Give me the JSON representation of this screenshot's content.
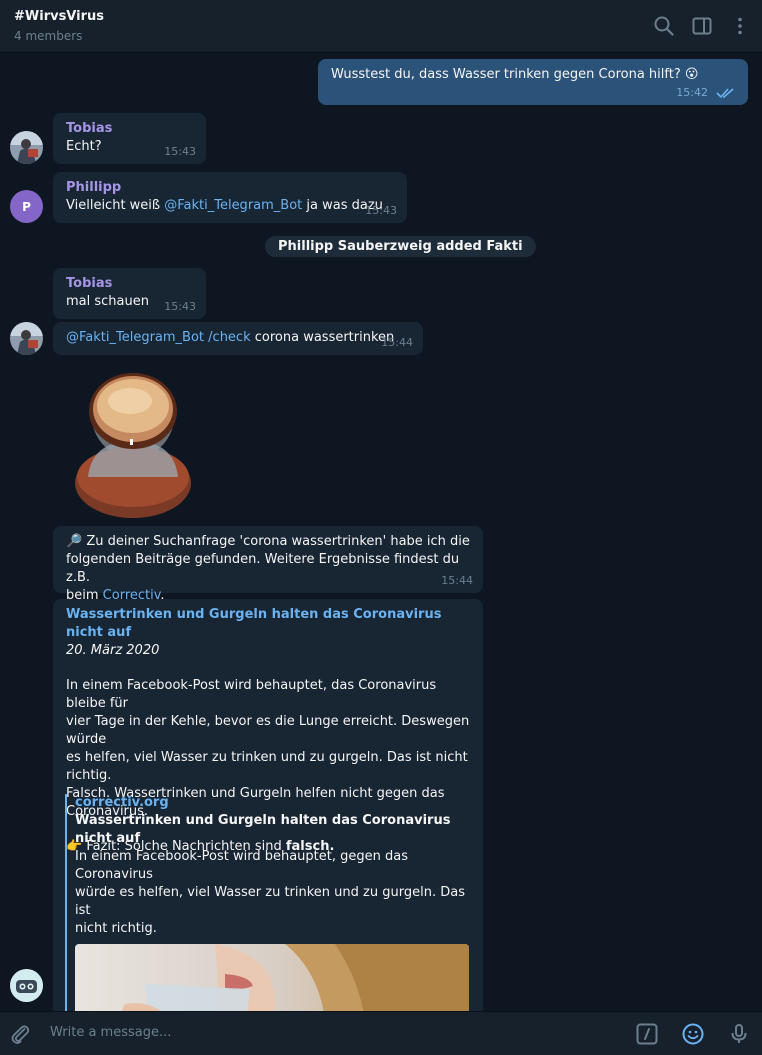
{
  "header": {
    "title": "#WirvsVirus",
    "subtitle": "4 members"
  },
  "messages": {
    "m1": {
      "text": "Wusstest du, dass Wasser trinken gegen Corona hilft? 😮",
      "time": "15:42"
    },
    "m2": {
      "sender": "Tobias",
      "text": "Echt?",
      "time": "15:43"
    },
    "m3": {
      "sender": "Phillipp",
      "avatar_letter": "P",
      "mention": "@Fakti_Telegram_Bot",
      "text_after": " ja was dazu",
      "text_before": "Vielleicht weiß ",
      "time": "15:43"
    },
    "service": "Phillipp Sauberzweig added Fakti",
    "m4": {
      "sender": "Tobias",
      "text": "mal schauen",
      "time": "15:43"
    },
    "m5": {
      "mention": "@Fakti_Telegram_Bot",
      "command": " /check",
      "text": " corona wassertrinken",
      "time": "15:44"
    },
    "m6": {
      "line1": "🔎 Zu deiner Suchanfrage 'corona wassertrinken' habe ich die",
      "line2": "folgenden Beiträge gefunden. Weitere Ergebnisse findest du z.B.",
      "line3_before": "beim ",
      "line3_link": "Correctiv",
      "line3_after": ".",
      "time": "15:44"
    },
    "m7": {
      "title": "Wassertrinken und Gurgeln halten das Coronavirus nicht auf",
      "date": "20. März 2020",
      "body1": "In einem Facebook-Post wird behauptet, das Coronavirus bleibe für",
      "body2": "vier Tage in der Kehle, bevor es die Lunge erreicht. Deswegen würde",
      "body3": "es helfen, viel Wasser zu trinken und zu gurgeln. Das ist nicht richtig.",
      "body4": "Falsch. Wassertrinken und Gurgeln helfen nicht gegen das",
      "body5": "Coronavirus.",
      "fazit_before": "👉 Fazit: Solche Nachrichten sind ",
      "fazit_bold": "falsch.",
      "preview_site": "correctiv.org",
      "preview_title": "Wassertrinken und Gurgeln halten das Coronavirus nicht auf",
      "preview_body1": "In einem Facebook-Post wird behauptet, gegen das Coronavirus",
      "preview_body2": "würde es helfen, viel Wasser zu trinken und zu gurgeln. Das ist",
      "preview_body3": "nicht richtig."
    }
  },
  "composer": {
    "placeholder": "Write a message..."
  },
  "icons": {
    "header": [
      "search-icon",
      "sidebar-toggle-icon",
      "more-vertical-icon"
    ],
    "composer": [
      "attach-icon",
      "bot-command-icon",
      "emoji-icon",
      "microphone-icon"
    ]
  },
  "colors": {
    "background": "#0e1621",
    "header": "#17212b",
    "incoming_bubble": "#182533",
    "outgoing_bubble": "#2b5278",
    "link": "#6ab3f3",
    "sender_name": "#a695e7"
  }
}
